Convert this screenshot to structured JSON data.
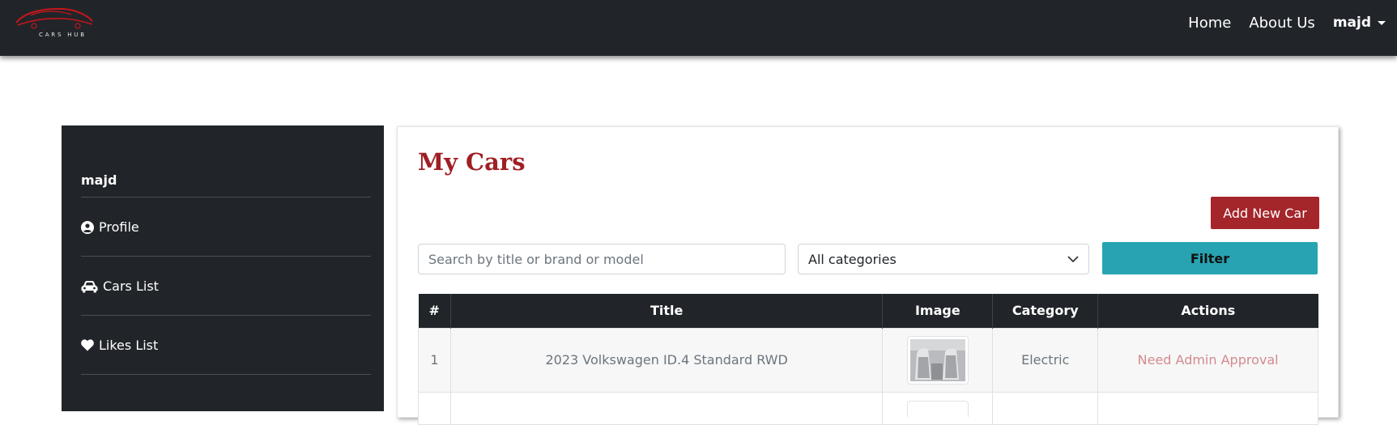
{
  "navbar": {
    "brand_text": "CARS HUB",
    "links": [
      "Home",
      "About Us"
    ],
    "user": "majd",
    "colors": {
      "bg": "#212529",
      "logo": "#c4161c"
    }
  },
  "sidebar": {
    "username": "majd",
    "items": [
      {
        "label": "Profile",
        "icon": "user-circle-icon"
      },
      {
        "label": "Cars List",
        "icon": "car-icon"
      },
      {
        "label": "Likes List",
        "icon": "heart-icon"
      }
    ]
  },
  "main": {
    "title": "My Cars",
    "add_button": "Add New Car",
    "search_placeholder": "Search by title or brand or model",
    "category_select": "All categories",
    "filter_button": "Filter",
    "table": {
      "headers": [
        "#",
        "Title",
        "Image",
        "Category",
        "Actions"
      ],
      "rows": [
        {
          "num": "1",
          "title": "2023 Volkswagen ID.4 Standard RWD",
          "image": "car-interior-thumbnail",
          "category": "Electric",
          "action": "Need Admin Approval"
        }
      ]
    },
    "colors": {
      "title": "#a01f24",
      "add_button": "#a4252a",
      "filter_button": "#27a3b1",
      "status": "#d38a8e"
    }
  }
}
